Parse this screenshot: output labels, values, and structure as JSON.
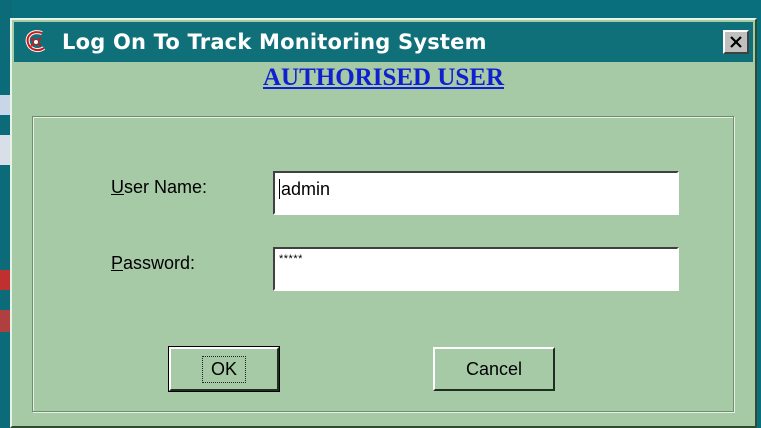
{
  "window": {
    "title": "Log On To Track Monitoring System",
    "close_label": "X"
  },
  "header": {
    "title": "AUTHORISED USER"
  },
  "form": {
    "username": {
      "label_accel": "U",
      "label_rest": "ser Name:",
      "value": "admin"
    },
    "password": {
      "label_accel": "P",
      "label_rest": "assword:",
      "value": "*****"
    }
  },
  "buttons": {
    "ok_label": "OK",
    "cancel_label": "Cancel"
  },
  "colors": {
    "dialog_bg": "#a6c9a6",
    "titlebar_bg": "#10707a",
    "header_link": "#1020d0",
    "desktop": "#0a6f7c"
  },
  "icons": {
    "app": "app-logo-icon",
    "close": "close-icon"
  }
}
